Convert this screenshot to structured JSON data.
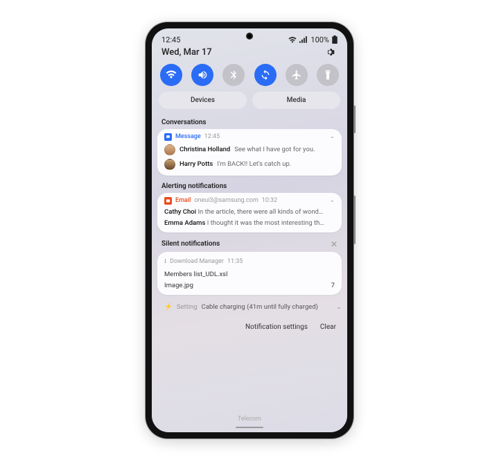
{
  "status": {
    "time": "12:45",
    "battery": "100%"
  },
  "header": {
    "date": "Wed, Mar 17"
  },
  "pills": {
    "devices": "Devices",
    "media": "Media"
  },
  "sections": {
    "conversations": "Conversations",
    "alerting": "Alerting notifications",
    "silent": "Silent notifications"
  },
  "convo": {
    "app": "Message",
    "time": "12:45",
    "items": [
      {
        "sender": "Christina Holland",
        "preview": "See what I have got for you."
      },
      {
        "sender": "Harry Potts",
        "preview": "I'm BACK!! Let's catch up."
      }
    ]
  },
  "alert": {
    "app": "Email",
    "account": "oneui3@samsung.com",
    "time": "10:32",
    "items": [
      {
        "sender": "Cathy Choi",
        "preview": "In the article, there were all kinds of wond…"
      },
      {
        "sender": "Emma Adams",
        "preview": "I thought it was the most interesting th…"
      }
    ]
  },
  "silent": {
    "dl": {
      "app": "Download Manager",
      "time": "11:35",
      "files": [
        {
          "name": "Members list_UDL.xsl",
          "count": ""
        },
        {
          "name": "Image.jpg",
          "count": "7"
        }
      ]
    },
    "setting": {
      "app": "Setting",
      "text": "Cable charging (41m until fully charged)"
    }
  },
  "footer": {
    "settings": "Notification settings",
    "clear": "Clear"
  },
  "carrier": "Telecom"
}
